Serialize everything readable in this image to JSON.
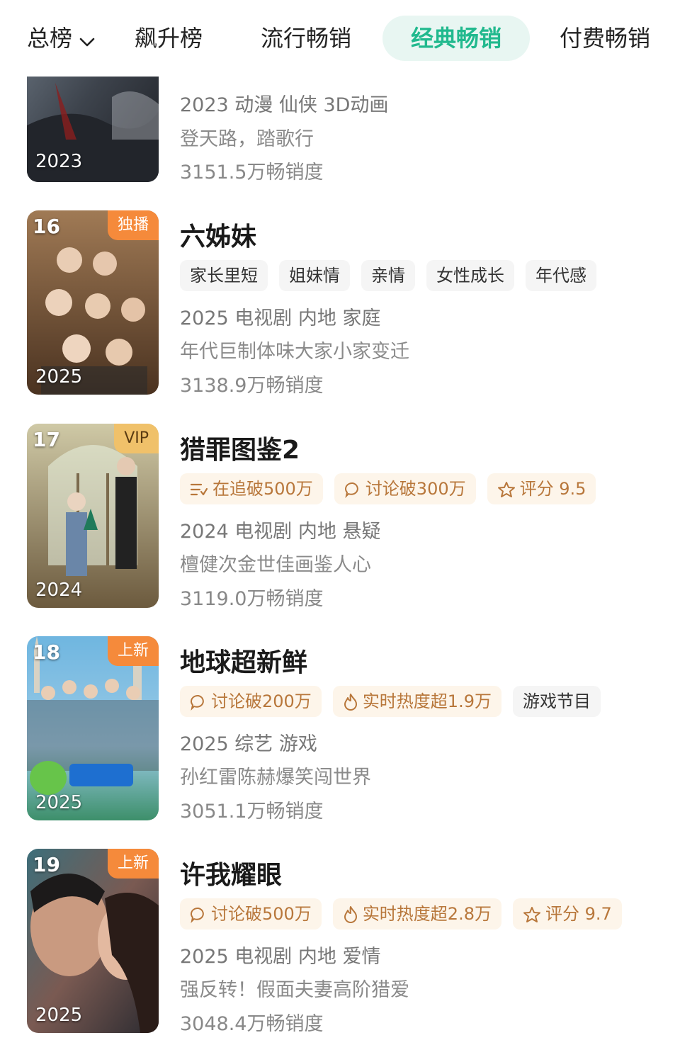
{
  "tabs": {
    "overall": "总榜",
    "rising": "飙升榜",
    "popular": "流行畅销",
    "classic": "经典畅销",
    "paid": "付费畅销"
  },
  "colors": {
    "accent": "#21b98e",
    "badge_orange": "#f58a3b",
    "badge_vip": "#f0c16a"
  },
  "items": [
    {
      "year_overlay": "2023",
      "info": "2023 动漫 仙侠 3D动画",
      "desc": "登天路，踏歌行",
      "sales": "3151.5万畅销度"
    },
    {
      "rank": "16",
      "badge": "独播",
      "year_overlay": "2025",
      "title": "六姊妹",
      "tags": [
        "家长里短",
        "姐妹情",
        "亲情",
        "女性成长",
        "年代感"
      ],
      "info": "2025 电视剧 内地 家庭",
      "desc": "年代巨制体味大家小家变迁",
      "sales": "3138.9万畅销度"
    },
    {
      "rank": "17",
      "badge": "VIP",
      "year_overlay": "2024",
      "title": "猎罪图鉴2",
      "tags": [
        {
          "icon": "follow-list-icon",
          "text": "在追破500万"
        },
        {
          "icon": "comment-icon",
          "text": "讨论破300万"
        },
        {
          "icon": "star-icon",
          "text": "评分 9.5"
        }
      ],
      "info": "2024 电视剧 内地 悬疑",
      "desc": "檀健次金世佳画鉴人心",
      "sales": "3119.0万畅销度"
    },
    {
      "rank": "18",
      "badge": "上新",
      "year_overlay": "2025",
      "title": "地球超新鲜",
      "tags": [
        {
          "icon": "comment-icon",
          "text": "讨论破200万"
        },
        {
          "icon": "flame-icon",
          "text": "实时热度超1.9万"
        },
        {
          "icon": "",
          "text": "游戏节目"
        }
      ],
      "info": "2025 综艺 游戏",
      "desc": "孙红雷陈赫爆笑闯世界",
      "sales": "3051.1万畅销度"
    },
    {
      "rank": "19",
      "badge": "上新",
      "year_overlay": "2025",
      "title": "许我耀眼",
      "tags": [
        {
          "icon": "comment-icon",
          "text": "讨论破500万"
        },
        {
          "icon": "flame-icon",
          "text": "实时热度超2.8万"
        },
        {
          "icon": "star-icon",
          "text": "评分 9.7"
        }
      ],
      "info": "2025 电视剧 内地 爱情",
      "desc": "强反转！假面夫妻高阶猎爱",
      "sales": "3048.4万畅销度"
    }
  ]
}
